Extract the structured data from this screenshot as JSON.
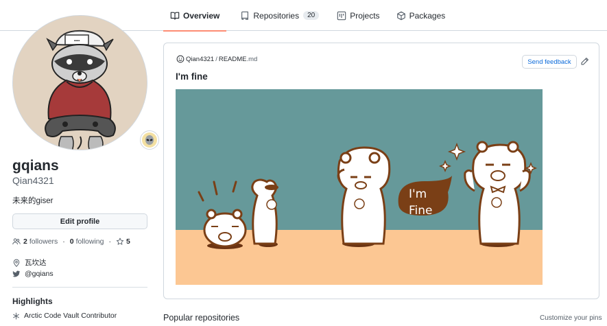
{
  "tabs": [
    {
      "label": "Overview",
      "icon": "book-icon",
      "active": true
    },
    {
      "label": "Repositories",
      "icon": "repo-icon",
      "count": "20"
    },
    {
      "label": "Projects",
      "icon": "project-icon"
    },
    {
      "label": "Packages",
      "icon": "package-icon"
    }
  ],
  "profile": {
    "fullname": "gqians",
    "username": "Qian4321",
    "bio": "未来的giser",
    "edit_label": "Edit profile",
    "followers_count": "2",
    "followers_label": "followers",
    "following_count": "0",
    "following_label": "following",
    "stars_count": "5",
    "location": "瓦坎达",
    "twitter": "@gqians"
  },
  "highlights": {
    "title": "Highlights",
    "items": [
      "Arctic Code Vault Contributor"
    ]
  },
  "readme": {
    "owner": "Qian4321",
    "separator": "/",
    "file": "README",
    "ext": ".md",
    "feedback_label": "Send feedback",
    "title": "I'm fine",
    "image_text_line1": "I'm",
    "image_text_line2": "Fine"
  },
  "popular": {
    "title": "Popular repositories",
    "customize_label": "Customize your pins"
  },
  "colors": {
    "accent_tab": "#fd8c73",
    "link": "#0969da",
    "image_sky": "#66999a",
    "image_ground": "#fcc793",
    "speech_bubble": "#7a3f16"
  }
}
